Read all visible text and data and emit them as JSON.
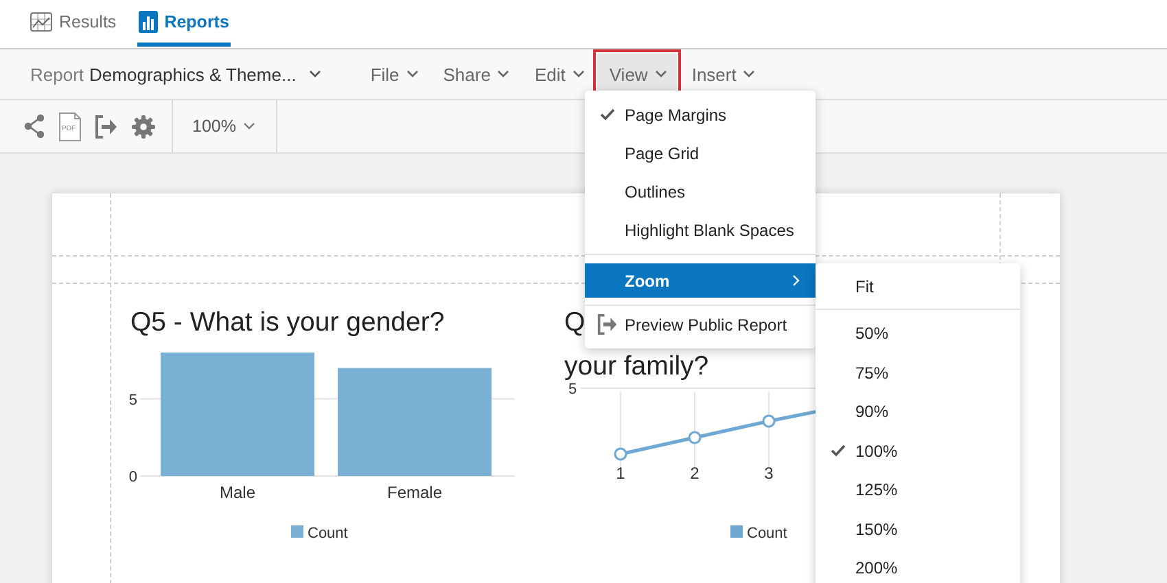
{
  "nav_tabs": [
    {
      "label": "Results",
      "selected": false
    },
    {
      "label": "Reports",
      "selected": true
    }
  ],
  "report_bar": {
    "prefix": "Report",
    "name": "Demographics & Theme...",
    "menus": [
      {
        "label": "File",
        "selected": false,
        "highlighted": false
      },
      {
        "label": "Share",
        "selected": false,
        "highlighted": false
      },
      {
        "label": "Edit",
        "selected": false,
        "highlighted": false
      },
      {
        "label": "View",
        "selected": true,
        "highlighted": true
      },
      {
        "label": "Insert",
        "selected": false,
        "highlighted": false
      }
    ]
  },
  "toolbar": {
    "pdf_label": "PDF",
    "zoom": "100%"
  },
  "report_page": {
    "gender_chart": {
      "title": "Q5 - What is your gender?",
      "chart_data": {
        "type": "bar",
        "categories": [
          "Male",
          "Female"
        ],
        "series": [
          {
            "name": "Count",
            "color": "#7ab0d4",
            "values": [
              8,
              7
            ]
          }
        ],
        "ylim": [
          0,
          8
        ],
        "yticks": [
          0,
          5
        ]
      }
    },
    "family_chart": {
      "title_lines": [
        "Q",
        "your family?"
      ],
      "y_tick": "5",
      "x_labels": [
        "1",
        "2",
        "3"
      ],
      "legend": "Count"
    }
  },
  "view_menu": {
    "toggles": [
      {
        "label": "Page Margins",
        "checked": true
      },
      {
        "label": "Page Grid",
        "checked": false
      },
      {
        "label": "Outlines",
        "checked": false
      },
      {
        "label": "Highlight Blank Spaces",
        "checked": false
      }
    ],
    "submenu": {
      "label": "Zoom",
      "selected": true
    },
    "action": {
      "label": "Preview Public Report"
    }
  },
  "zoom_menu": {
    "fit": {
      "label": "Fit",
      "checked": false
    },
    "levels": [
      {
        "label": "50%",
        "checked": false
      },
      {
        "label": "75%",
        "checked": false
      },
      {
        "label": "90%",
        "checked": false
      },
      {
        "label": "100%",
        "checked": true
      },
      {
        "label": "125%",
        "checked": false
      },
      {
        "label": "150%",
        "checked": false
      },
      {
        "label": "200%",
        "checked": false
      }
    ]
  }
}
